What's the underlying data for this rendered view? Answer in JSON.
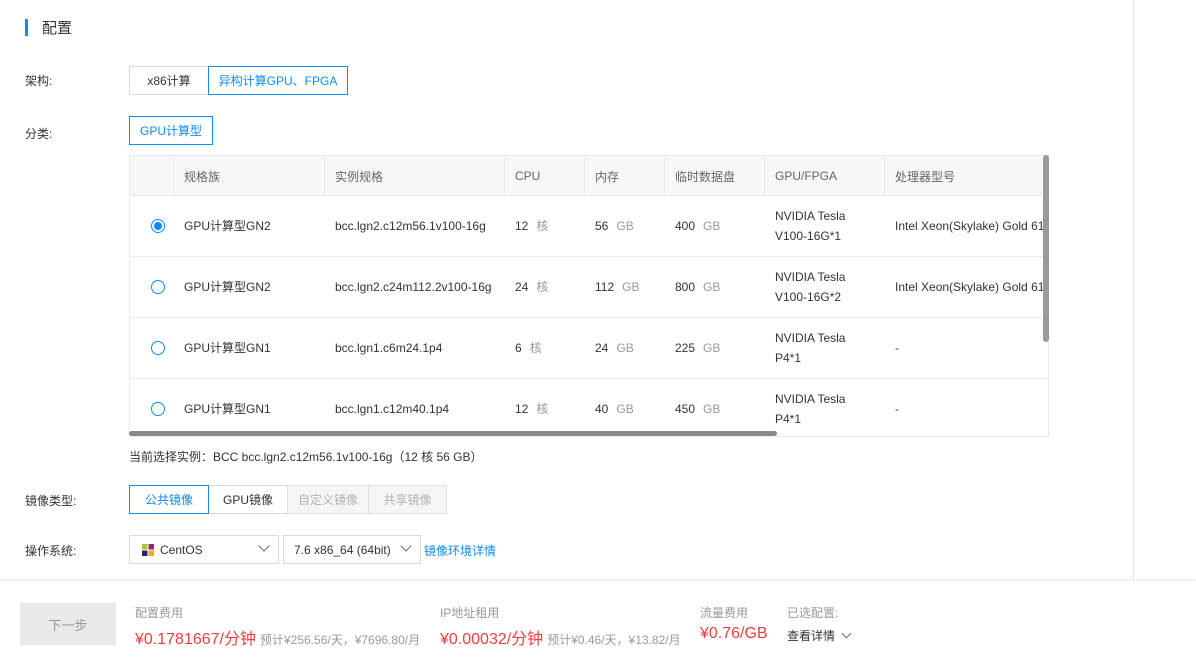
{
  "section": {
    "title": "配置"
  },
  "arch": {
    "label": "架构:",
    "options": [
      "x86计算",
      "异构计算GPU、FPGA"
    ]
  },
  "category": {
    "label": "分类:",
    "option": "GPU计算型"
  },
  "table": {
    "headers": [
      "规格族",
      "实例规格",
      "CPU",
      "内存",
      "临时数据盘",
      "GPU/FPGA",
      "处理器型号"
    ],
    "rows": [
      {
        "family": "GPU计算型GN2",
        "spec": "bcc.lgn2.c12m56.1v100-16g",
        "cpu": "12",
        "cpu_unit": "核",
        "mem": "56",
        "mem_unit": "GB",
        "disk": "400",
        "disk_unit": "GB",
        "gpu_line1": "NVIDIA Tesla",
        "gpu_line2": "V100-16G*1",
        "cpu_model": "Intel Xeon(Skylake) Gold 61",
        "selected": true
      },
      {
        "family": "GPU计算型GN2",
        "spec": "bcc.lgn2.c24m112.2v100-16g",
        "cpu": "24",
        "cpu_unit": "核",
        "mem": "112",
        "mem_unit": "GB",
        "disk": "800",
        "disk_unit": "GB",
        "gpu_line1": "NVIDIA Tesla",
        "gpu_line2": "V100-16G*2",
        "cpu_model": "Intel Xeon(Skylake) Gold 61",
        "selected": false
      },
      {
        "family": "GPU计算型GN1",
        "spec": "bcc.lgn1.c6m24.1p4",
        "cpu": "6",
        "cpu_unit": "核",
        "mem": "24",
        "mem_unit": "GB",
        "disk": "225",
        "disk_unit": "GB",
        "gpu_line1": "NVIDIA Tesla",
        "gpu_line2": "P4*1",
        "cpu_model": "-",
        "selected": false
      },
      {
        "family": "GPU计算型GN1",
        "spec": "bcc.lgn1.c12m40.1p4",
        "cpu": "12",
        "cpu_unit": "核",
        "mem": "40",
        "mem_unit": "GB",
        "disk": "450",
        "disk_unit": "GB",
        "gpu_line1": "NVIDIA Tesla",
        "gpu_line2": "P4*1",
        "cpu_model": "-",
        "selected": false
      }
    ]
  },
  "current_selection": "当前选择实例：BCC bcc.lgn2.c12m56.1v100-16g（12 核 56 GB）",
  "image_type": {
    "label": "镜像类型:",
    "options": [
      "公共镜像",
      "GPU镜像",
      "自定义镜像",
      "共享镜像"
    ]
  },
  "os": {
    "label": "操作系统:",
    "distro": "CentOS",
    "version": "7.6 x86_64 (64bit)",
    "detail_link": "镜像环境详情"
  },
  "footer": {
    "next_button": "下一步",
    "config_fee_label": "配置费用",
    "config_fee_value": "¥0.1781667/分钟",
    "config_fee_est": "预计¥256.56/天，¥7696.80/月",
    "ip_fee_label": "IP地址租用",
    "ip_fee_value": "¥0.00032/分钟",
    "ip_fee_est": "预计¥0.46/天，¥13.82/月",
    "traffic_fee_label": "流量费用",
    "traffic_fee_value": "¥0.76/GB",
    "selected_config_label": "已选配置:",
    "view_detail": "查看详情"
  },
  "colors": {
    "accent": "#108cee",
    "price": "#f33e3e"
  }
}
